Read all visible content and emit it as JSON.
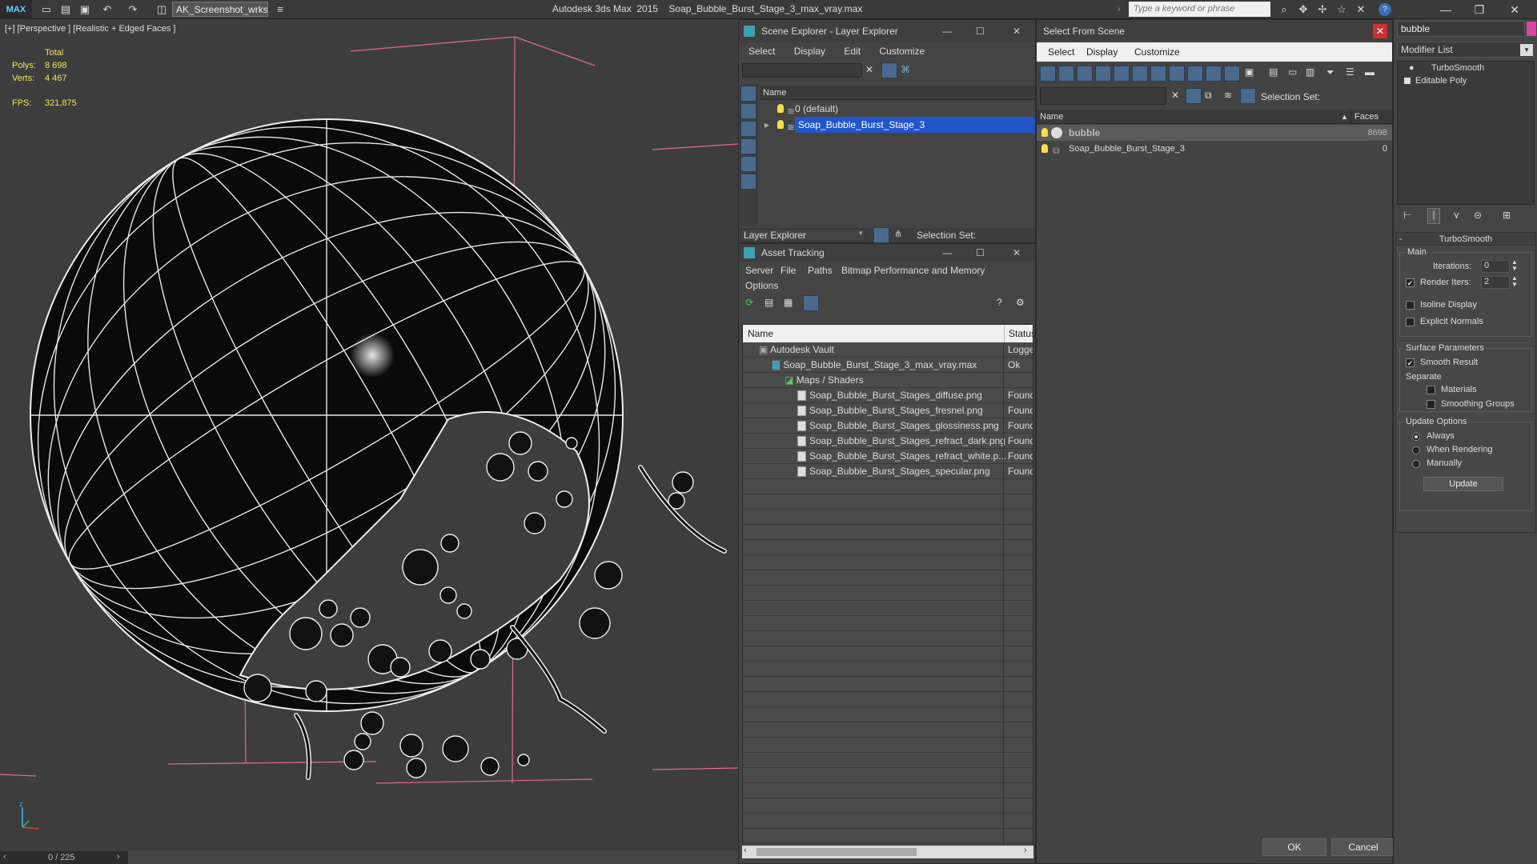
{
  "titlebar": {
    "logo": "MAX",
    "workspace": "AK_Screenshot_wrksp",
    "title": "Autodesk 3ds Max  2015    Soap_Bubble_Burst_Stage_3_max_vray.max",
    "search_placeholder": "Type a keyword or phrase"
  },
  "viewport": {
    "label": "[+] [Perspective ] [Realistic + Edged Faces ]",
    "total_label": "Total",
    "polys_label": "Polys:",
    "polys_value": "8 698",
    "verts_label": "Verts:",
    "verts_value": "4 467",
    "fps_label": "FPS:",
    "fps_value": "321,875",
    "axis_z": "z",
    "timeline": "0 / 225"
  },
  "scene_explorer": {
    "title": "Scene Explorer - Layer Explorer",
    "menu": [
      "Select",
      "Display",
      "Edit",
      "Customize"
    ],
    "col_name": "Name",
    "rows": [
      {
        "label": "0 (default)",
        "selected": false
      },
      {
        "label": "Soap_Bubble_Burst_Stage_3",
        "selected": true
      }
    ],
    "footer_dropdown": "Layer Explorer",
    "selection_set": "Selection Set:"
  },
  "asset_tracking": {
    "title": "Asset Tracking",
    "menu": [
      "Server",
      "File",
      "Paths",
      "Bitmap Performance and Memory",
      "Options"
    ],
    "col_name": "Name",
    "col_status": "Status",
    "rows": [
      {
        "name": "Autodesk Vault",
        "status": "Logged",
        "indent": 1
      },
      {
        "name": "Soap_Bubble_Burst_Stage_3_max_vray.max",
        "status": "Ok",
        "indent": 2
      },
      {
        "name": "Maps / Shaders",
        "status": "",
        "indent": 3
      },
      {
        "name": "Soap_Bubble_Burst_Stages_diffuse.png",
        "status": "Found",
        "indent": 4
      },
      {
        "name": "Soap_Bubble_Burst_Stages_fresnel.png",
        "status": "Found",
        "indent": 4
      },
      {
        "name": "Soap_Bubble_Burst_Stages_glossiness.png",
        "status": "Found",
        "indent": 4
      },
      {
        "name": "Soap_Bubble_Burst_Stages_refract_dark.png",
        "status": "Found",
        "indent": 4
      },
      {
        "name": "Soap_Bubble_Burst_Stages_refract_white.p...",
        "status": "Found",
        "indent": 4
      },
      {
        "name": "Soap_Bubble_Burst_Stages_specular.png",
        "status": "Found",
        "indent": 4
      }
    ]
  },
  "select_from_scene": {
    "title": "Select From Scene",
    "menu": [
      "Select",
      "Display",
      "Customize"
    ],
    "selection_set": "Selection Set:",
    "col_name": "Name",
    "col_faces": "Faces",
    "rows": [
      {
        "name": "bubble",
        "faces": "8698",
        "selected": true
      },
      {
        "name": "Soap_Bubble_Burst_Stage_3",
        "faces": "0",
        "selected": false
      }
    ],
    "ok": "OK",
    "cancel": "Cancel"
  },
  "command_panel": {
    "object_name": "bubble",
    "modifier_list": "Modifier List",
    "stack": [
      "TurboSmooth",
      "Editable Poly"
    ],
    "rollout_title": "TurboSmooth",
    "main_label": "Main",
    "iterations_label": "Iterations:",
    "iterations_value": "0",
    "render_iters_label": "Render Iters:",
    "render_iters_value": "2",
    "render_iters_checked": true,
    "isoline_label": "Isoline Display",
    "isoline_checked": false,
    "explicit_normals_label": "Explicit Normals",
    "explicit_normals_checked": false,
    "surface_params_label": "Surface Parameters",
    "smooth_result_label": "Smooth Result",
    "smooth_result_checked": true,
    "separate_label": "Separate",
    "materials_label": "Materials",
    "smoothing_groups_label": "Smoothing Groups",
    "update_options_label": "Update Options",
    "update_always": "Always",
    "update_rendering": "When Rendering",
    "update_manually": "Manually",
    "update_selected": "Always",
    "update_button": "Update"
  },
  "colors": {
    "selection": "#2255c8",
    "stat_text": "#f2e35e",
    "wire": "#ffffff",
    "grid_pink": "#e06a98"
  }
}
